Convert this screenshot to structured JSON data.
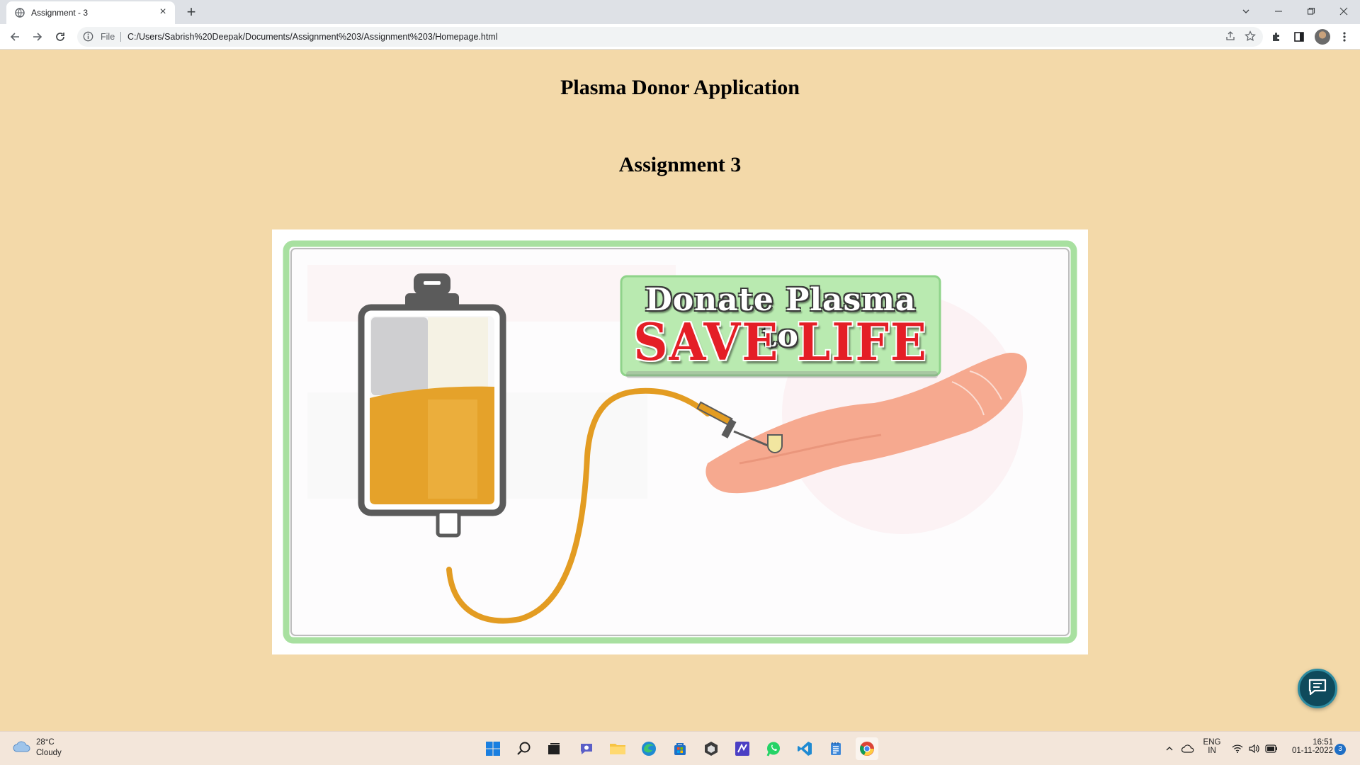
{
  "browser": {
    "tab_title": "Assignment - 3",
    "omnibox_scheme": "File",
    "url": "C:/Users/Sabrish%20Deepak/Documents/Assignment%203/Assignment%203/Homepage.html"
  },
  "page": {
    "title": "Plasma Donor Application",
    "subtitle": "Assignment 3",
    "poster": {
      "banner_line1": "Donate Plasma to",
      "banner_line2": "SAVE LIFE",
      "accent_colors": {
        "frame_green": "#a8e0a0",
        "banner_red": "#e41e26",
        "plasma": "#e5a22a",
        "bag_grey": "#5b5b5b",
        "hand": "#f6a98f"
      }
    }
  },
  "taskbar": {
    "weather_temp": "28°C",
    "weather_condition": "Cloudy",
    "language_line1": "ENG",
    "language_line2": "IN",
    "time": "16:51",
    "date": "01-11-2022",
    "notification_count": "3",
    "apps": [
      "start",
      "search",
      "task-view",
      "teams-chat",
      "file-explorer",
      "edge",
      "microsoft-store",
      "unity",
      "visual-studio",
      "whatsapp",
      "vscode",
      "notepad",
      "chrome"
    ]
  },
  "colors": {
    "page_bg": "#f3d9a9",
    "taskbar_bg": "#f3e6da",
    "chat_fab": "#0f4a5c"
  }
}
